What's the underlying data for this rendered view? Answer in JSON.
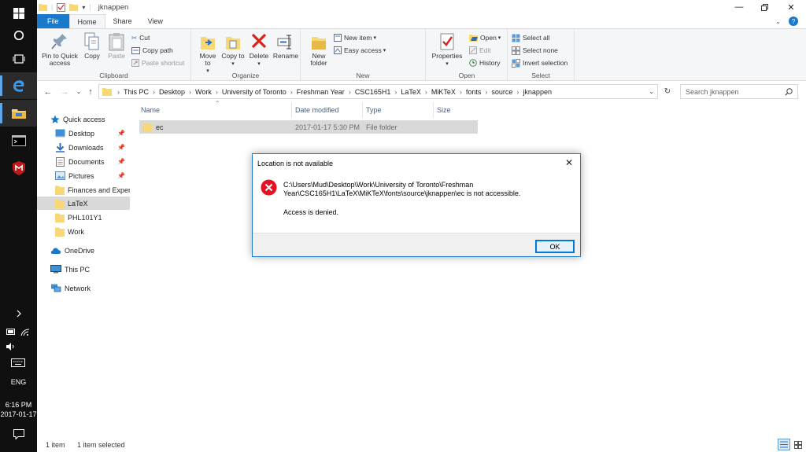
{
  "window": {
    "title": "jknappen"
  },
  "ribbon_tabs": [
    "File",
    "Home",
    "Share",
    "View"
  ],
  "ribbon": {
    "clipboard": {
      "label": "Clipboard",
      "pin": "Pin to Quick access",
      "copy": "Copy",
      "paste": "Paste",
      "cut": "Cut",
      "copy_path": "Copy path",
      "paste_shortcut": "Paste shortcut"
    },
    "organize": {
      "label": "Organize",
      "move_to": "Move to",
      "copy_to": "Copy to",
      "delete": "Delete",
      "rename": "Rename"
    },
    "new": {
      "label": "New",
      "new_folder": "New folder",
      "new_item": "New item",
      "easy_access": "Easy access"
    },
    "open": {
      "label": "Open",
      "properties": "Properties",
      "open": "Open",
      "edit": "Edit",
      "history": "History"
    },
    "select": {
      "label": "Select",
      "select_all": "Select all",
      "select_none": "Select none",
      "invert": "Invert selection"
    }
  },
  "breadcrumb": [
    "This PC",
    "Desktop",
    "Work",
    "University of Toronto",
    "Freshman Year",
    "CSC165H1",
    "LaTeX",
    "MiKTeX",
    "fonts",
    "source",
    "jknappen"
  ],
  "search": {
    "placeholder": "Search jknappen"
  },
  "nav": {
    "quick_access": "Quick access",
    "items": [
      "Desktop",
      "Downloads",
      "Documents",
      "Pictures",
      "Finances and Expen",
      "LaTeX",
      "PHL101Y1",
      "Work"
    ],
    "onedrive": "OneDrive",
    "this_pc": "This PC",
    "network": "Network"
  },
  "columns": [
    "Name",
    "Date modified",
    "Type",
    "Size"
  ],
  "files": [
    {
      "name": "ec",
      "date": "2017-01-17 5:30 PM",
      "type": "File folder",
      "size": ""
    }
  ],
  "status": {
    "count": "1 item",
    "selected": "1 item selected"
  },
  "dialog": {
    "title": "Location is not available",
    "message": "C:\\Users\\Mud\\Desktop\\Work\\University of Toronto\\Freshman Year\\CSC165H1\\LaTeX\\MiKTeX\\fonts\\source\\jknappen\\ec is not accessible.",
    "detail": "Access is denied.",
    "ok": "OK"
  },
  "taskbar": {
    "lang": "ENG",
    "time": "6:16 PM",
    "date": "2017-01-17"
  },
  "colors": {
    "accent": "#1979ca",
    "error": "#e81123",
    "folder": "#f8d775",
    "taskbar": "#101010"
  }
}
